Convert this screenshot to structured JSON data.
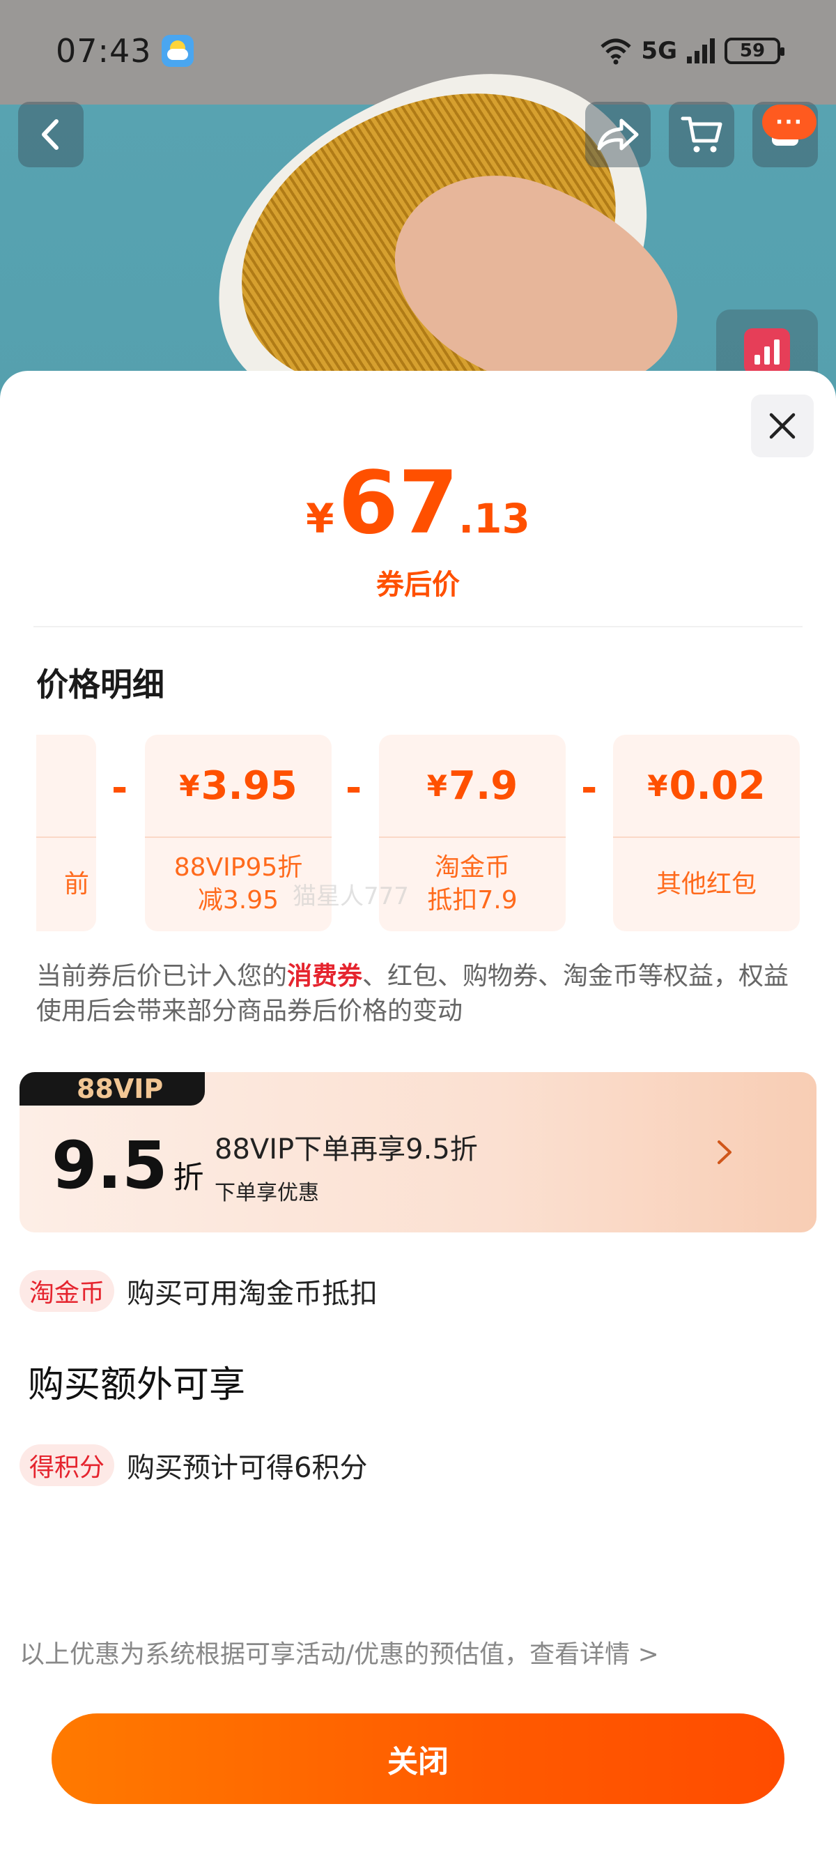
{
  "status_bar": {
    "time": "07:43",
    "signal_label": "5G",
    "battery": "59"
  },
  "top_nav": {
    "more_badge": "···"
  },
  "price": {
    "currency": "¥",
    "integer": "67",
    "decimal": ".13",
    "caption": "券后价"
  },
  "breakdown": {
    "title": "价格明细",
    "items": [
      {
        "amount": "",
        "desc": "前"
      },
      {
        "currency": "¥",
        "amount": "3.95",
        "desc_line1": "88VIP95折",
        "desc_line2": "减3.95"
      },
      {
        "currency": "¥",
        "amount": "7.9",
        "desc_line1": "淘金币",
        "desc_line2": "抵扣7.9"
      },
      {
        "currency": "¥",
        "amount": "0.02",
        "desc_line1": "其他红包",
        "desc_line2": ""
      }
    ],
    "operator": "-",
    "watermark": "猫星人777"
  },
  "disclaimer": {
    "prefix": "当前券后价已计入您的",
    "highlight": "消费券",
    "suffix": "、红包、购物券、淘金币等权益，权益使用后会带来部分商品券后价格的变动"
  },
  "vip": {
    "tag": "88VIP",
    "discount_value": "9.5",
    "discount_unit": "折",
    "title": "88VIP下单再享9.5折",
    "subtitle": "下单享优惠"
  },
  "benefits": {
    "coins_tag": "淘金币",
    "coins_text": "购买可用淘金币抵扣",
    "extra_title": "购买额外可享",
    "points_tag": "得积分",
    "points_text": "购买预计可得6积分"
  },
  "footer": {
    "note": "以上优惠为系统根据可享活动/优惠的预估值，查看详情 >",
    "close_label": "关闭"
  },
  "colors": {
    "accent": "#ff5000",
    "highlight_red": "#e5242e"
  }
}
